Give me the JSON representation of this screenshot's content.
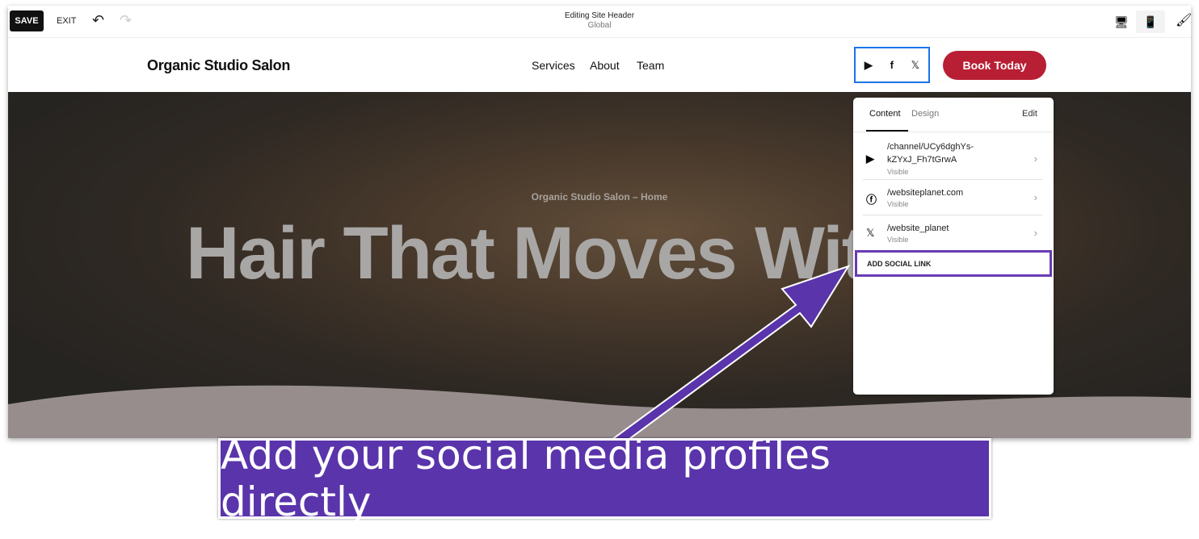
{
  "toolbar": {
    "save": "SAVE",
    "exit": "EXIT",
    "editing_title": "Editing Site Header",
    "editing_scope": "Global",
    "undo_icon": "↶",
    "redo_icon": "↷"
  },
  "site": {
    "logo": "Organic Studio Salon",
    "nav": [
      "Services",
      "About",
      "Team"
    ],
    "cta": "Book Today",
    "cta_color": "#b81f34"
  },
  "hero": {
    "subtitle": "Organic Studio Salon – Home",
    "title": "Hair That Moves With"
  },
  "panel": {
    "tabs": [
      "Content",
      "Design"
    ],
    "edit": "Edit",
    "links": [
      {
        "icon": "youtube-icon",
        "url": "/channel/UCy6dghYs-kZYxJ_Fh7tGrwA",
        "status": "Visible"
      },
      {
        "icon": "facebook-icon",
        "url": "/websiteplanet.com",
        "status": "Visible"
      },
      {
        "icon": "x-icon",
        "url": "/website_planet",
        "status": "Visible"
      }
    ],
    "add": "ADD SOCIAL LINK"
  },
  "callout": {
    "text": "Add your social media profiles directly",
    "color": "#5a34aa"
  }
}
